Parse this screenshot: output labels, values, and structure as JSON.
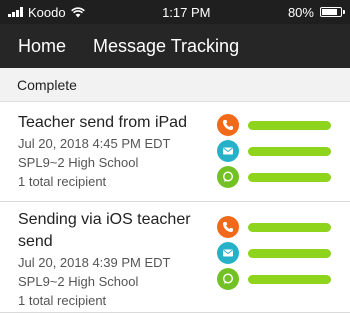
{
  "status_bar": {
    "carrier": "Koodo",
    "time": "1:17 PM",
    "battery": "80%",
    "battery_level": 0.8
  },
  "nav": {
    "home_label": "Home",
    "title": "Message Tracking"
  },
  "section": {
    "header": "Complete"
  },
  "messages": [
    {
      "title": "Teacher send from iPad",
      "date": "Jul 20, 2018 4:45 PM EDT",
      "school": "SPL9~2 High School",
      "recipients": "1 total recipient",
      "channels": [
        {
          "type": "phone",
          "icon": "phone-icon",
          "color": "#f06a19",
          "progress": 1.0
        },
        {
          "type": "email",
          "icon": "email-icon",
          "color": "#25b2c8",
          "progress": 1.0
        },
        {
          "type": "sms",
          "icon": "chat-bubble-icon",
          "color": "#74c126",
          "progress": 1.0
        }
      ]
    },
    {
      "title": "Sending via iOS teacher send",
      "date": "Jul 20, 2018 4:39 PM EDT",
      "school": "SPL9~2 High School",
      "recipients": "1 total recipient",
      "channels": [
        {
          "type": "phone",
          "icon": "phone-icon",
          "color": "#f06a19",
          "progress": 1.0
        },
        {
          "type": "email",
          "icon": "email-icon",
          "color": "#25b2c8",
          "progress": 1.0
        },
        {
          "type": "sms",
          "icon": "chat-bubble-icon",
          "color": "#74c126",
          "progress": 1.0
        }
      ]
    }
  ],
  "colors": {
    "progress_bar": "#8ed31c",
    "nav_background": "#262626",
    "status_background": "#1f1f1f"
  }
}
